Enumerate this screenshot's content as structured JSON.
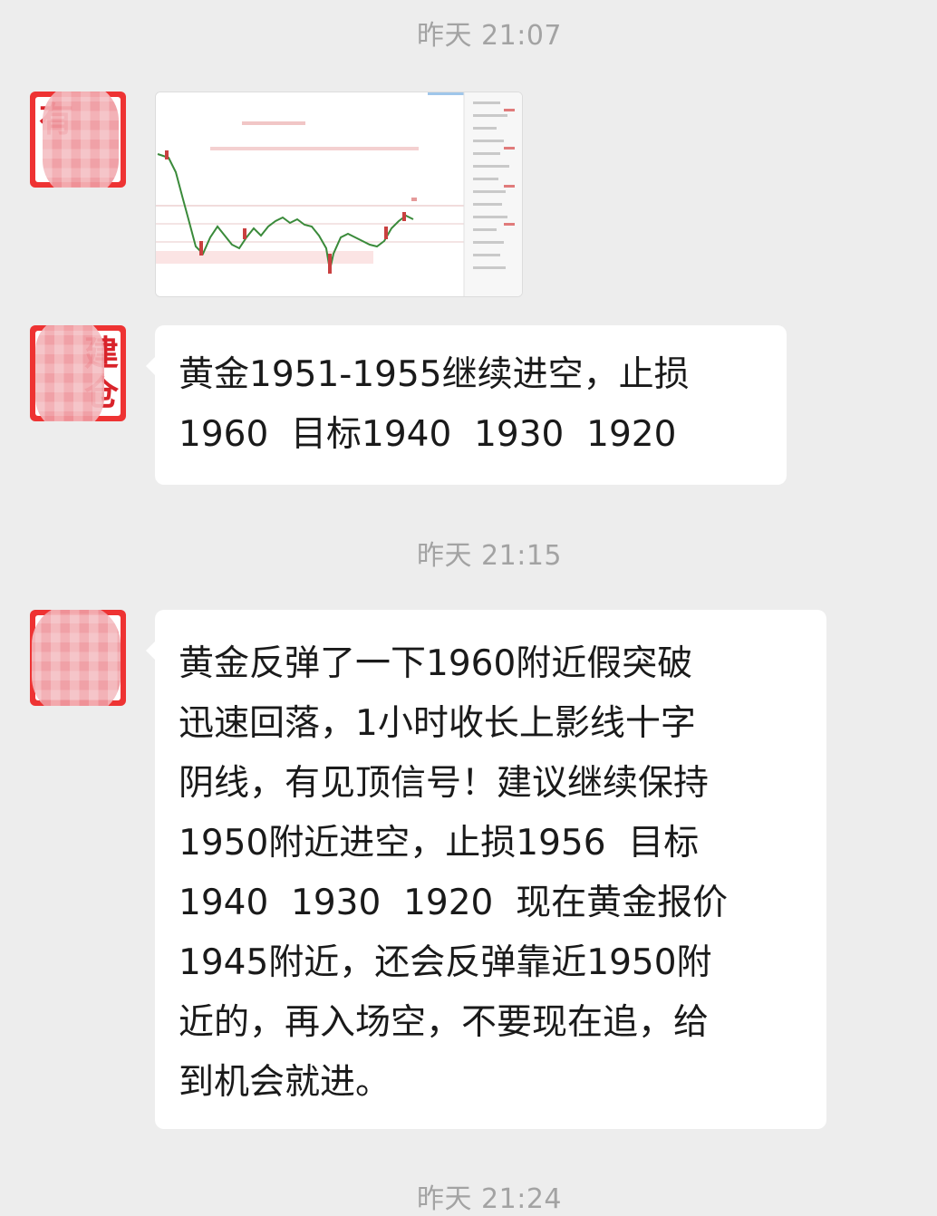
{
  "messages": [
    {
      "timestamp": "昨天 21:07",
      "type": "image",
      "image_icon": "candlestick-chart"
    },
    {
      "type": "text",
      "text": "黄金1951-1955继续进空，止损\n1960  目标1940  1930  1920"
    },
    {
      "timestamp": "昨天 21:15",
      "type": "text",
      "text": "黄金反弹了一下1960附近假突破\n迅速回落，1小时收长上影线十字\n阴线，有见顶信号！建议继续保持\n1950附近进空，止损1956  目标\n1940  1930  1920  现在黄金报价\n1945附近，还会反弹靠近1950附\n近的，再入场空，不要现在追，给\n到机会就进。"
    },
    {
      "timestamp": "昨天 21:24"
    }
  ],
  "avatar": {
    "glyph_top_left": "有",
    "glyph_top_right": "建",
    "glyph_bottom_right": "仓"
  },
  "colors": {
    "background": "#ededed",
    "bubble": "#ffffff",
    "timestamp": "#a3a3a3",
    "avatar_red": "#d9232a"
  }
}
